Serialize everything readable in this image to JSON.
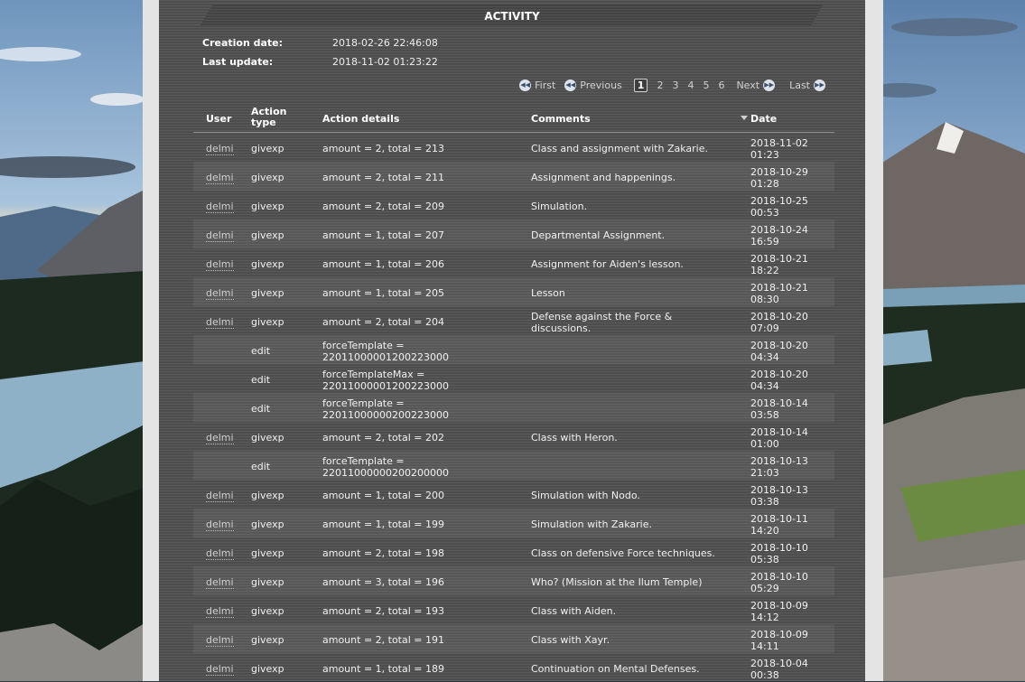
{
  "section": {
    "title": "ACTIVITY"
  },
  "meta": {
    "creation_label": "Creation date:",
    "creation_value": "2018-02-26 22:46:08",
    "update_label": "Last update:",
    "update_value": "2018-11-02 01:23:22"
  },
  "pager": {
    "first": "First",
    "previous": "Previous",
    "next": "Next",
    "last": "Last",
    "pages": [
      "1",
      "2",
      "3",
      "4",
      "5",
      "6"
    ],
    "current": "1",
    "first_icon": "double-left-icon",
    "previous_icon": "double-left-icon",
    "next_icon": "double-right-icon",
    "last_icon": "double-right-icon"
  },
  "table": {
    "headers": {
      "user": "User",
      "action_type_line1": "Action",
      "action_type_line2": "type",
      "details": "Action details",
      "comments": "Comments",
      "date": "Date"
    },
    "rows": [
      {
        "user": "delmi",
        "type": "givexp",
        "details": "amount = 2, total = 213",
        "comments": "Class and assignment with Zakarie.",
        "date1": "2018-11-02",
        "date2": "01:23"
      },
      {
        "user": "delmi",
        "type": "givexp",
        "details": "amount = 2, total = 211",
        "comments": "Assignment and happenings.",
        "date1": "2018-10-29",
        "date2": "01:28"
      },
      {
        "user": "delmi",
        "type": "givexp",
        "details": "amount = 2, total = 209",
        "comments": "Simulation.",
        "date1": "2018-10-25",
        "date2": "00:53"
      },
      {
        "user": "delmi",
        "type": "givexp",
        "details": "amount = 1, total = 207",
        "comments": "Departmental Assignment.",
        "date1": "2018-10-24",
        "date2": "16:59"
      },
      {
        "user": "delmi",
        "type": "givexp",
        "details": "amount = 1, total = 206",
        "comments": "Assignment for Aiden's lesson.",
        "date1": "2018-10-21",
        "date2": "18:22"
      },
      {
        "user": "delmi",
        "type": "givexp",
        "details": "amount = 1, total = 205",
        "comments": "Lesson",
        "date1": "2018-10-21",
        "date2": "08:30"
      },
      {
        "user": "delmi",
        "type": "givexp",
        "details": "amount = 2, total = 204",
        "comments": "Defense against the Force &",
        "comments2": "discussions.",
        "date1": "2018-10-20",
        "date2": "07:09"
      },
      {
        "user": "",
        "type": "edit",
        "details": "forceTemplate =",
        "details2": "2201100000120022300​0",
        "comments": "",
        "date1": "2018-10-20",
        "date2": "04:34"
      },
      {
        "user": "",
        "type": "edit",
        "details": "forceTemplateMax =",
        "details2": "22011000001200223000",
        "comments": "",
        "date1": "2018-10-20",
        "date2": "04:34"
      },
      {
        "user": "",
        "type": "edit",
        "details": "forceTemplate =",
        "details2": "22011000000200223000",
        "comments": "",
        "date1": "2018-10-14",
        "date2": "03:58"
      },
      {
        "user": "delmi",
        "type": "givexp",
        "details": "amount = 2, total = 202",
        "comments": "Class with Heron.",
        "date1": "2018-10-14",
        "date2": "01:00"
      },
      {
        "user": "",
        "type": "edit",
        "details": "forceTemplate =",
        "details2": "22011000000200200000",
        "comments": "",
        "date1": "2018-10-13",
        "date2": "21:03"
      },
      {
        "user": "delmi",
        "type": "givexp",
        "details": "amount = 1, total = 200",
        "comments": "Simulation with Nodo.",
        "date1": "2018-10-13",
        "date2": "03:38"
      },
      {
        "user": "delmi",
        "type": "givexp",
        "details": "amount = 1, total = 199",
        "comments": "Simulation with Zakarie.",
        "date1": "2018-10-11",
        "date2": "14:20"
      },
      {
        "user": "delmi",
        "type": "givexp",
        "details": "amount = 2, total = 198",
        "comments": "Class on defensive Force techniques.",
        "date1": "2018-10-10",
        "date2": "05:38"
      },
      {
        "user": "delmi",
        "type": "givexp",
        "details": "amount = 3, total = 196",
        "comments": "Who? (Mission at the Ilum Temple)",
        "date1": "2018-10-10",
        "date2": "05:29"
      },
      {
        "user": "delmi",
        "type": "givexp",
        "details": "amount = 2, total = 193",
        "comments": "Class with Aiden.",
        "date1": "2018-10-09",
        "date2": "14:12"
      },
      {
        "user": "delmi",
        "type": "givexp",
        "details": "amount = 2, total = 191",
        "comments": "Class with Xayr.",
        "date1": "2018-10-09",
        "date2": "14:11"
      },
      {
        "user": "delmi",
        "type": "givexp",
        "details": "amount = 1, total = 189",
        "comments": "Continuation on Mental Defenses.",
        "date1": "2018-10-04",
        "date2": "00:38"
      }
    ]
  }
}
